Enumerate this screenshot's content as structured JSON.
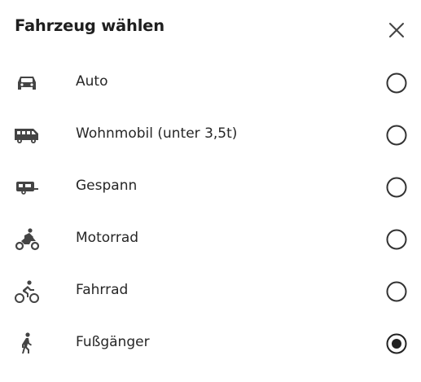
{
  "dialog": {
    "title": "Fahrzeug wählen",
    "close_icon": "close-icon"
  },
  "options": [
    {
      "label": "Auto",
      "icon": "car-icon",
      "selected": false
    },
    {
      "label": "Wohnmobil (unter 3,5t)",
      "icon": "motorhome-icon",
      "selected": false
    },
    {
      "label": "Gespann",
      "icon": "caravan-icon",
      "selected": false
    },
    {
      "label": "Motorrad",
      "icon": "motorcycle-icon",
      "selected": false
    },
    {
      "label": "Fahrrad",
      "icon": "bicycle-icon",
      "selected": false
    },
    {
      "label": "Fußgänger",
      "icon": "pedestrian-icon",
      "selected": true
    }
  ],
  "colors": {
    "text": "#262626",
    "icon": "#444444",
    "radio": "#333333"
  }
}
